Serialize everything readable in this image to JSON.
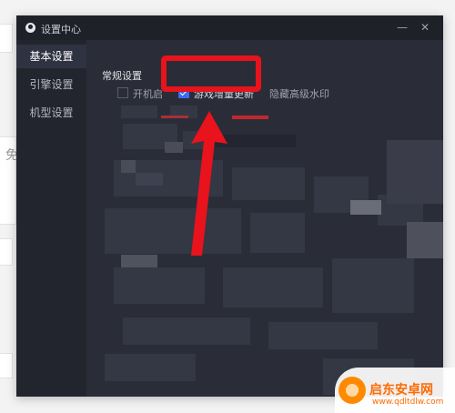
{
  "window": {
    "title": "设置中心",
    "minimize_glyph": "—",
    "close_glyph": "✕"
  },
  "sidebar": {
    "items": [
      {
        "label": "基本设置",
        "active": true
      },
      {
        "label": "引擎设置",
        "active": false
      },
      {
        "label": "机型设置",
        "active": false
      }
    ]
  },
  "content": {
    "section_title": "常规设置",
    "options": [
      {
        "label": "开机启",
        "checked": false
      },
      {
        "label": "游戏增量更新",
        "checked": true
      },
      {
        "label": "隐藏高级水印",
        "checked": false
      }
    ]
  },
  "background_app": {
    "partial_text": "免"
  },
  "watermark": {
    "title": "启东安卓网",
    "url": "www.qdltdlw.com"
  },
  "colors": {
    "annotation": "#e8131c",
    "accent": "#3a6cf0",
    "window_bg": "#2a2d38"
  }
}
